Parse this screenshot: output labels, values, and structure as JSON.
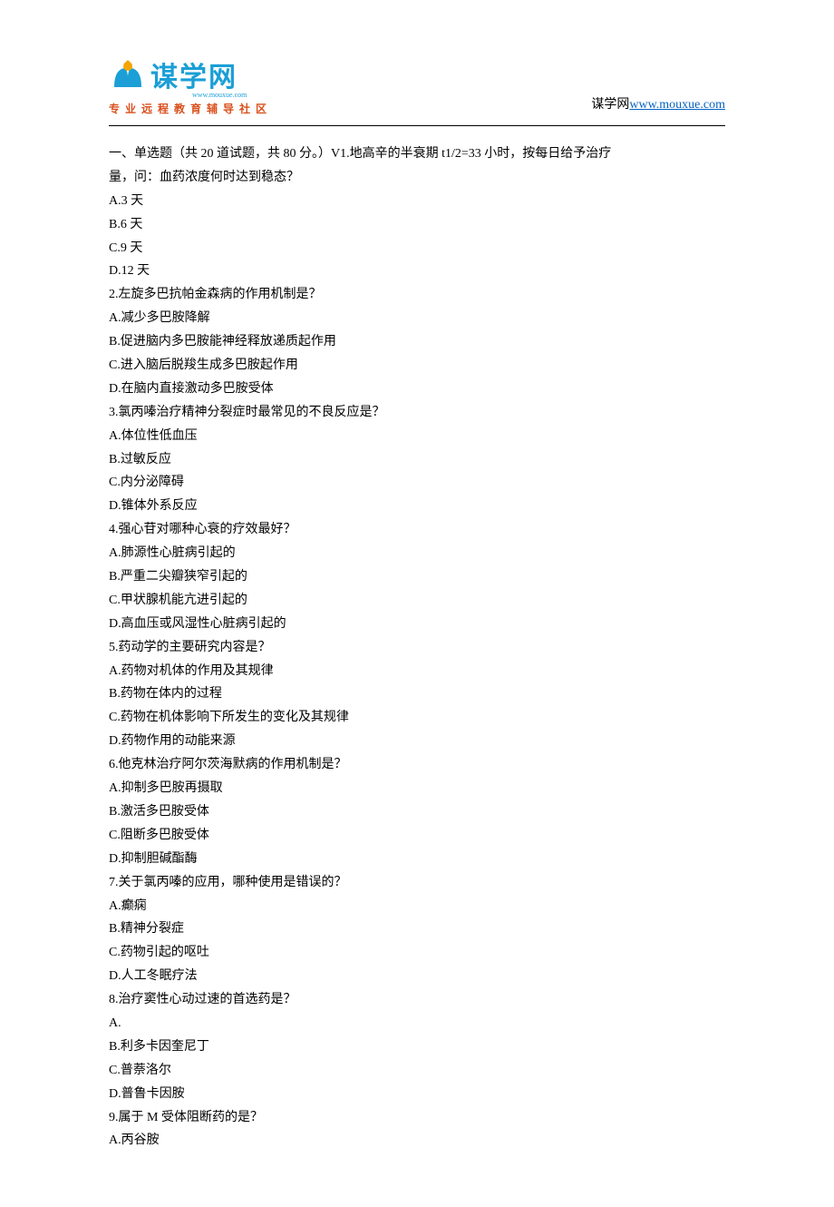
{
  "header": {
    "logo_main": "谋学网",
    "logo_sub": "www.mouxue.com",
    "logo_tagline": "专业远程教育辅导社区",
    "site_label": "谋学网",
    "site_url": "www.mouxue.com"
  },
  "lines": [
    "一、单选题（共 20 道试题，共 80 分。）V1.地高辛的半衰期 t1/2=33 小时，按每日给予治疗",
    "量，问：血药浓度何时达到稳态？",
    "A.3 天",
    "B.6 天",
    "C.9 天",
    "D.12 天",
    "2.左旋多巴抗帕金森病的作用机制是？",
    "A.减少多巴胺降解",
    "B.促进脑内多巴胺能神经释放递质起作用",
    "C.进入脑后脱羧生成多巴胺起作用",
    "D.在脑内直接激动多巴胺受体",
    "3.氯丙嗪治疗精神分裂症时最常见的不良反应是？",
    "A.体位性低血压",
    "B.过敏反应",
    "C.内分泌障碍",
    "D.锥体外系反应",
    "4.强心苷对哪种心衰的疗效最好？",
    "A.肺源性心脏病引起的",
    "B.严重二尖瓣狭窄引起的",
    "C.甲状腺机能亢进引起的",
    "D.高血压或风湿性心脏病引起的",
    "5.药动学的主要研究内容是？",
    "A.药物对机体的作用及其规律",
    "B.药物在体内的过程",
    "C.药物在机体影响下所发生的变化及其规律",
    "D.药物作用的动能来源",
    "6.他克林治疗阿尔茨海默病的作用机制是？",
    "A.抑制多巴胺再摄取",
    "B.激活多巴胺受体",
    "C.阻断多巴胺受体",
    "D.抑制胆碱酯酶",
    "7.关于氯丙嗪的应用，哪种使用是错误的？",
    "A.癫痫",
    "B.精神分裂症",
    "C.药物引起的呕吐",
    "D.人工冬眠疗法",
    "8.治疗窦性心动过速的首选药是？",
    "A.",
    "B.利多卡因奎尼丁",
    "C.普萘洛尔",
    "D.普鲁卡因胺",
    "9.属于 M 受体阻断药的是？",
    "A.丙谷胺"
  ]
}
